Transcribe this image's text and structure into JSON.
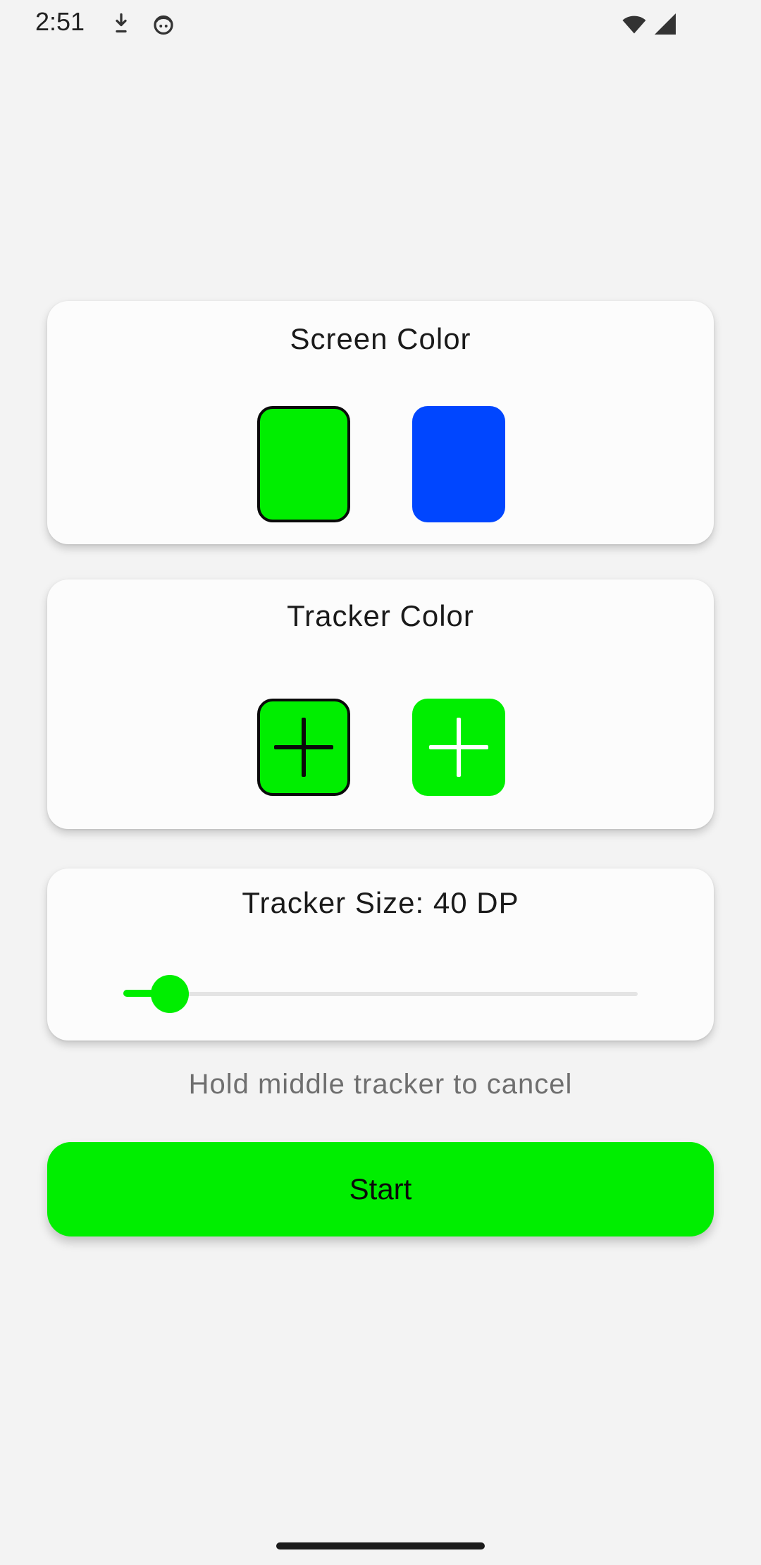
{
  "status_bar": {
    "time": "2:51",
    "icons": [
      "download-icon",
      "face-icon",
      "wifi-icon",
      "cellular-signal-icon"
    ]
  },
  "screen_color_card": {
    "title": "Screen Color",
    "options": [
      {
        "name": "green",
        "color": "#00ee00",
        "selected": true
      },
      {
        "name": "blue",
        "color": "#0046ff",
        "selected": false
      }
    ]
  },
  "tracker_color_card": {
    "title": "Tracker Color",
    "options": [
      {
        "name": "black-plus-on-green",
        "background": "#00ee00",
        "plus_color": "#0a0a0a",
        "selected": true
      },
      {
        "name": "white-plus-on-green",
        "background": "#00ee00",
        "plus_color": "#ffffff",
        "selected": false
      }
    ]
  },
  "tracker_size_card": {
    "label": "Tracker Size: 40 DP",
    "slider_fraction": 0.09
  },
  "hint_text": "Hold middle tracker to cancel",
  "start_button": {
    "label": "Start"
  },
  "colors": {
    "accent": "#00ee00",
    "card_background": "#fcfcfc",
    "page_background": "#f3f3f3"
  }
}
